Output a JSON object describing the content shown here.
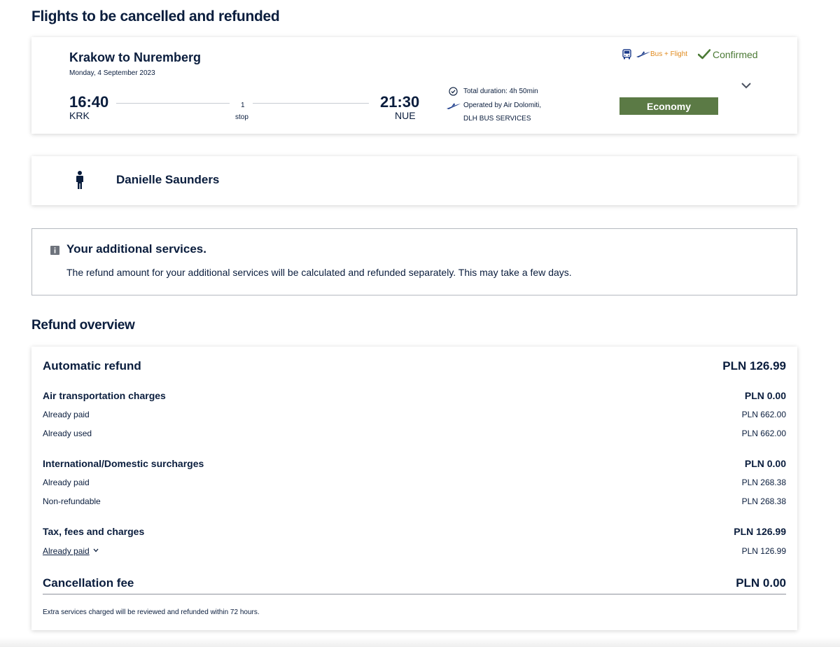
{
  "page": {
    "title": "Flights to be cancelled and refunded",
    "refund_title": "Refund overview"
  },
  "flight": {
    "route": "Krakow to Nuremberg",
    "date": "Monday, 4 September 2023",
    "departure_time": "16:40",
    "departure_code": "KRK",
    "arrival_time": "21:30",
    "arrival_code": "NUE",
    "stops_count": "1",
    "stops_label": "stop",
    "duration": "Total duration: 4h 50min",
    "operated_by": "Operated by Air Dolomiti,",
    "operated_by_2": "DLH BUS SERVICES",
    "trip_type": "Bus + Flight",
    "status": "Confirmed",
    "cabin": "Economy",
    "status_color": "#4b7a35",
    "cabin_color": "#5b7a45",
    "trip_type_color": "#e08a1e"
  },
  "passenger": {
    "name": "Danielle Saunders"
  },
  "info": {
    "title": "Your additional services.",
    "text": "The refund amount for your additional services will be calculated and refunded separately. This may take a few days."
  },
  "refund": {
    "automatic_label": "Automatic refund",
    "automatic_amount": "PLN  126.99",
    "air": {
      "label": "Air transportation charges",
      "amount": "PLN  0.00",
      "paid_label": "Already paid",
      "paid_amount": "PLN  662.00",
      "used_label": "Already used",
      "used_amount": "PLN  662.00"
    },
    "surcharges": {
      "label": "International/Domestic surcharges",
      "amount": "PLN  0.00",
      "paid_label": "Already paid",
      "paid_amount": "PLN  268.38",
      "nonref_label": "Non-refundable",
      "nonref_amount": "PLN  268.38"
    },
    "tax": {
      "label": "Tax, fees and charges",
      "amount": "PLN  126.99",
      "paid_label": "Already paid",
      "paid_amount": "PLN  126.99"
    },
    "cancellation_label": "Cancellation fee",
    "cancellation_amount": "PLN  0.00",
    "footnote": "Extra services charged will be reviewed and refunded within 72 hours."
  }
}
